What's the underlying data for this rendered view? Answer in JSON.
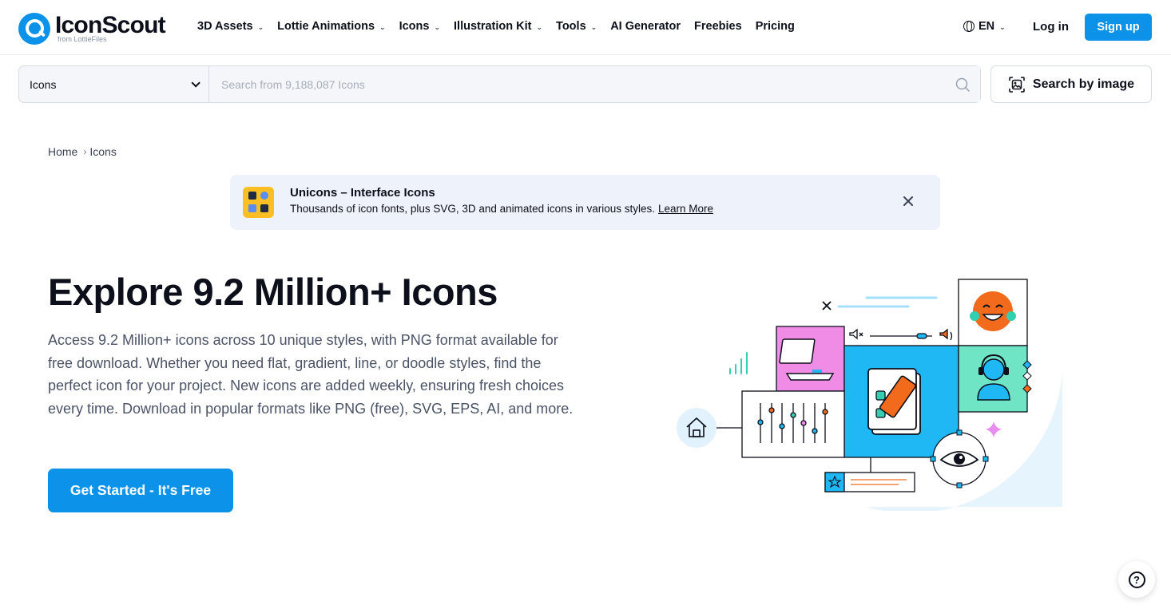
{
  "header": {
    "logo_text": "IconScout",
    "logo_sub": "from LottieFiles",
    "nav": [
      {
        "label": "3D Assets",
        "has_caret": true
      },
      {
        "label": "Lottie Animations",
        "has_caret": true
      },
      {
        "label": "Icons",
        "has_caret": true
      },
      {
        "label": "Illustration Kit",
        "has_caret": true
      },
      {
        "label": "Tools",
        "has_caret": true
      },
      {
        "label": "AI Generator",
        "has_caret": false
      },
      {
        "label": "Freebies",
        "has_caret": false
      },
      {
        "label": "Pricing",
        "has_caret": false
      }
    ],
    "language": "EN",
    "login_label": "Log in",
    "signup_label": "Sign up"
  },
  "search": {
    "category": "Icons",
    "placeholder": "Search from 9,188,087 Icons",
    "value": "",
    "image_search_label": "Search by image"
  },
  "breadcrumb": {
    "items": [
      "Home",
      "Icons"
    ],
    "separator": "›"
  },
  "banner": {
    "title": "Unicons – Interface Icons",
    "description": "Thousands of icon fonts, plus SVG, 3D and animated icons in various styles.",
    "link_label": "Learn More"
  },
  "hero": {
    "title": "Explore 9.2 Million+ Icons",
    "description": "Access 9.2 Million+ icons across 10 unique styles, with PNG format available for free download. Whether you need flat, gradient, line, or doodle styles, find the perfect icon for your project. New icons are added weekly, ensuring fresh choices every time. Download in popular formats like PNG (free), SVG, EPS, AI, and more.",
    "cta_label": "Get Started - It's Free"
  },
  "help": {
    "label": "?"
  },
  "colors": {
    "brand": "#0c92e8",
    "banner_bg": "#eef3fb",
    "banner_icon": "#fbbf24",
    "illus_blue": "#1fb8f5",
    "illus_pink": "#f18ce6",
    "illus_mint": "#6fe5c6",
    "illus_orange": "#f26b1d"
  },
  "icons": [
    "search-icon",
    "chevron-down-icon",
    "globe-icon",
    "image-search-icon",
    "close-icon",
    "help-icon"
  ]
}
